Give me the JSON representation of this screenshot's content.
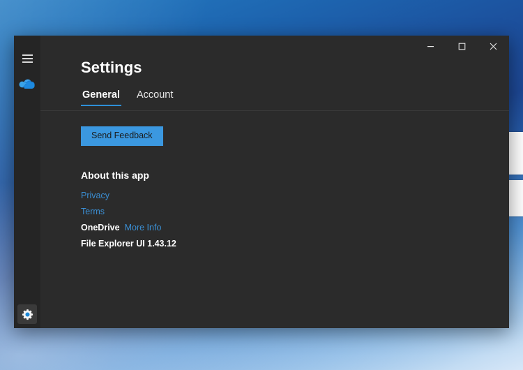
{
  "desktop": {
    "wallpaper_top_color": "#1c4f9c",
    "wallpaper_bottom_color": "#c3dcf3"
  },
  "background_window": {
    "fill_color": "#ffffff",
    "band_color": "#1c4f9c"
  },
  "window": {
    "title": "Settings",
    "background_color": "#2b2b2b",
    "sidebar_color": "#252525",
    "controls": {
      "minimize_label": "─",
      "minimize_icon": "minimize-icon",
      "maximize_label": "☐",
      "maximize_icon": "maximize-icon",
      "close_label": "✕",
      "close_icon": "close-icon"
    }
  },
  "sidebar": {
    "hamburger_icon": "hamburger-menu-icon",
    "onedrive_icon": "onedrive-cloud-icon",
    "gear_icon": "settings-gear-icon",
    "accent_color": "#2e8fd8"
  },
  "tabs": [
    {
      "label": "General",
      "active": true
    },
    {
      "label": "Account",
      "active": false
    }
  ],
  "main": {
    "send_feedback_label": "Send Feedback",
    "send_feedback_color": "#3b98e0",
    "about_heading": "About this app",
    "links": {
      "privacy": "Privacy",
      "terms": "Terms",
      "more_info": "More Info",
      "link_color": "#3b8fd4"
    },
    "product_name": "OneDrive",
    "version_line": "File Explorer UI 1.43.12"
  }
}
